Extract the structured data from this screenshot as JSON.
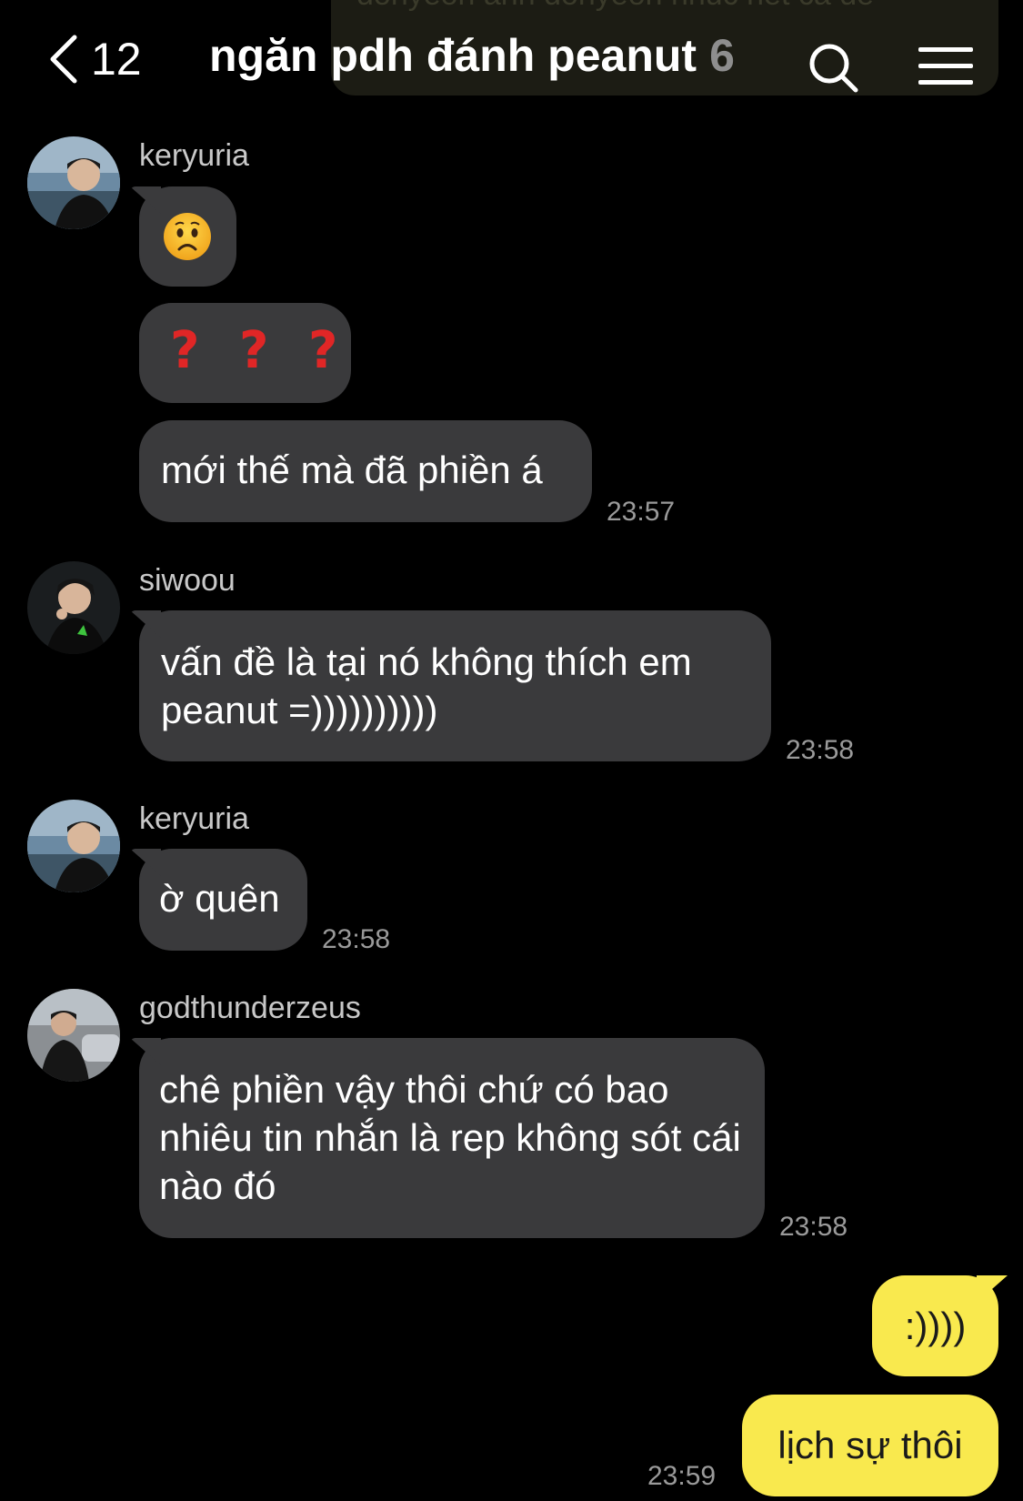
{
  "header": {
    "back_count": "12",
    "title": "ngăn pdh đánh peanut",
    "member_count": "6",
    "pinned_notice_text": "donyeon anh donyeon nhuc net cả đế"
  },
  "messages": [
    {
      "sender": "keryuria",
      "bubbles": [
        "😟",
        "? ? ?",
        "mới thế mà đã phiền á"
      ],
      "time": "23:57"
    },
    {
      "sender": "siwoou",
      "bubbles": [
        "vấn đề là tại nó không thích em peanut =))))))))))"
      ],
      "time": "23:58"
    },
    {
      "sender": "keryuria",
      "bubbles": [
        "ờ quên"
      ],
      "time": "23:58"
    },
    {
      "sender": "godthunderzeus",
      "bubbles": [
        "chê phiền vậy thôi chứ có bao nhiêu tin nhắn là rep không sót cái nào đó"
      ],
      "time": "23:58"
    }
  ],
  "own_messages": {
    "bubbles": [
      ":))))",
      "lịch sự thôi"
    ],
    "time": "23:59"
  },
  "icons": [
    "chevron-left-icon",
    "search-icon",
    "menu-icon",
    "worried-face-emoji",
    "red-question-mark-icon"
  ],
  "colors": {
    "background": "#000000",
    "bubble_other": "#3a3a3c",
    "bubble_own": "#f9e94e",
    "timestamp": "#9a9a9a",
    "question_mark": "#e02626"
  }
}
